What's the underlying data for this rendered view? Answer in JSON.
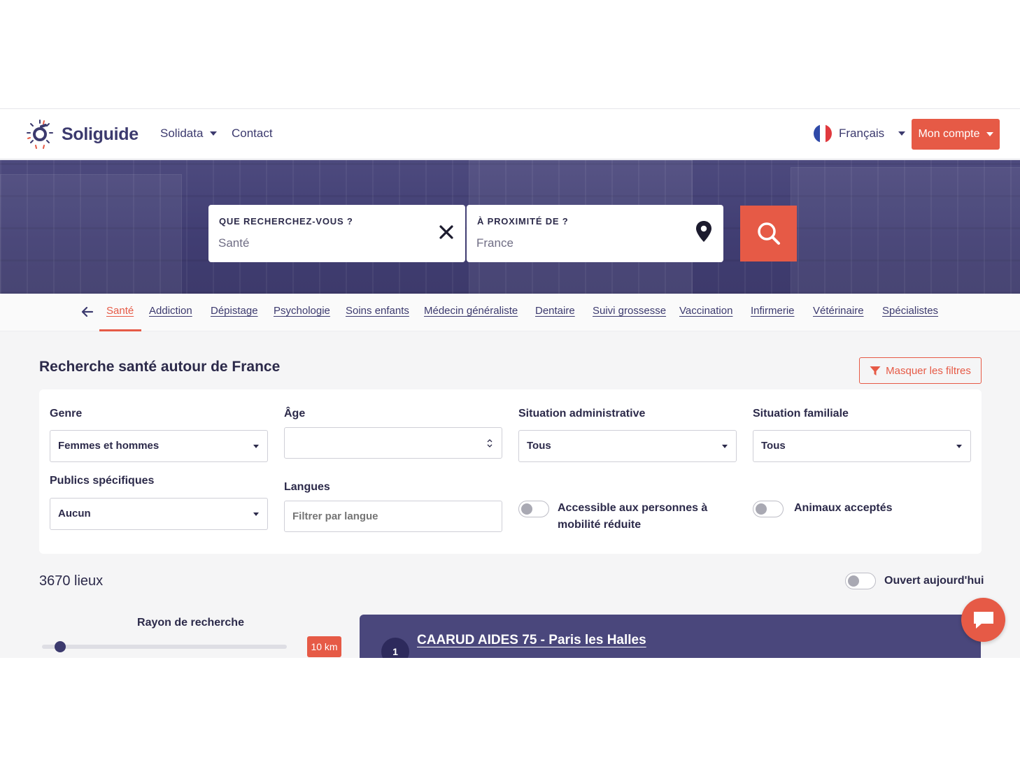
{
  "header": {
    "brand": "Soliguide",
    "nav": [
      {
        "label": "Solidata",
        "dropdown": true
      },
      {
        "label": "Contact",
        "dropdown": false
      }
    ],
    "language": "Français",
    "account_label": "Mon compte"
  },
  "search": {
    "what_label": "QUE RECHERCHEZ-VOUS ?",
    "what_value": "Santé",
    "where_label": "À PROXIMITÉ DE ?",
    "where_value": "France"
  },
  "categories": [
    "Santé",
    "Addiction",
    "Dépistage",
    "Psychologie",
    "Soins enfants",
    "Médecin généraliste",
    "Dentaire",
    "Suivi grossesse",
    "Vaccination",
    "Infirmerie",
    "Vétérinaire",
    "Spécialistes"
  ],
  "active_category": "Santé",
  "results_header": {
    "title": "Recherche santé autour de France",
    "toggle_filters_label": "Masquer les filtres"
  },
  "filters": {
    "genre": {
      "label": "Genre",
      "value": "Femmes et hommes"
    },
    "age": {
      "label": "Âge",
      "value": ""
    },
    "situation_admin": {
      "label": "Situation administrative",
      "value": "Tous"
    },
    "situation_familiale": {
      "label": "Situation familiale",
      "value": "Tous"
    },
    "publics": {
      "label": "Publics spécifiques",
      "value": "Aucun"
    },
    "langues": {
      "label": "Langues",
      "placeholder": "Filtrer par langue"
    },
    "pmr": {
      "label": "Accessible aux personnes à mobilité réduite",
      "on": false
    },
    "animaux": {
      "label": "Animaux acceptés",
      "on": false
    }
  },
  "results": {
    "count_label": "3670 lieux",
    "open_today": {
      "label": "Ouvert aujourd'hui",
      "on": false
    },
    "radius": {
      "title": "Rayon de recherche",
      "value_label": "10 km",
      "fraction": 0.05
    },
    "first": {
      "number": "1",
      "name": "CAARUD AIDES 75 - Paris les Halles"
    }
  },
  "colors": {
    "brand": "#3c3a6e",
    "accent": "#e65a46",
    "hero": "#433f75"
  },
  "icons": [
    "logo-icon",
    "chevron-down-icon",
    "france-flag-icon",
    "close-icon",
    "map-pin-icon",
    "search-icon",
    "arrow-left-icon",
    "filter-icon",
    "spin-arrows-icon",
    "chat-icon"
  ]
}
